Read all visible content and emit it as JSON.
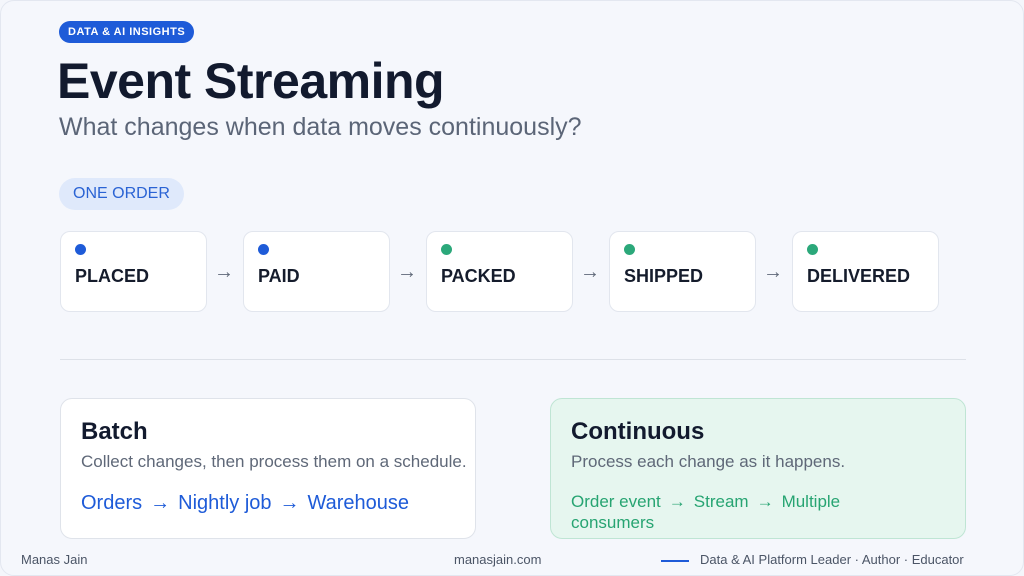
{
  "header": {
    "badge": "DATA & AI INSIGHTS",
    "title": "Event Streaming",
    "subtitle": "What changes when data moves continuously?"
  },
  "flow": {
    "label": "ONE ORDER",
    "arrow": "→",
    "stages": [
      {
        "label": "PLACED",
        "dot_color": "#1e5bd8"
      },
      {
        "label": "PAID",
        "dot_color": "#1e5bd8"
      },
      {
        "label": "PACKED",
        "dot_color": "#2ba87a"
      },
      {
        "label": "SHIPPED",
        "dot_color": "#2ba87a"
      },
      {
        "label": "DELIVERED",
        "dot_color": "#2ba87a"
      }
    ]
  },
  "batch": {
    "title": "Batch",
    "description": "Collect changes, then process them on a schedule.",
    "chain": [
      "Orders",
      "Nightly job",
      "Warehouse"
    ]
  },
  "continuous": {
    "title": "Continuous",
    "description": "Process each change as it happens.",
    "chain": [
      "Order event",
      "Stream",
      "Multiple consumers"
    ]
  },
  "footer": {
    "author": "Manas Jain",
    "website": "manasjain.com",
    "tagline": "Data & AI Platform Leader · Author · Educator"
  },
  "colors": {
    "accent_blue": "#1e5bd8",
    "accent_green": "#2ba87a",
    "continuous_bg": "#e6f6ef"
  }
}
